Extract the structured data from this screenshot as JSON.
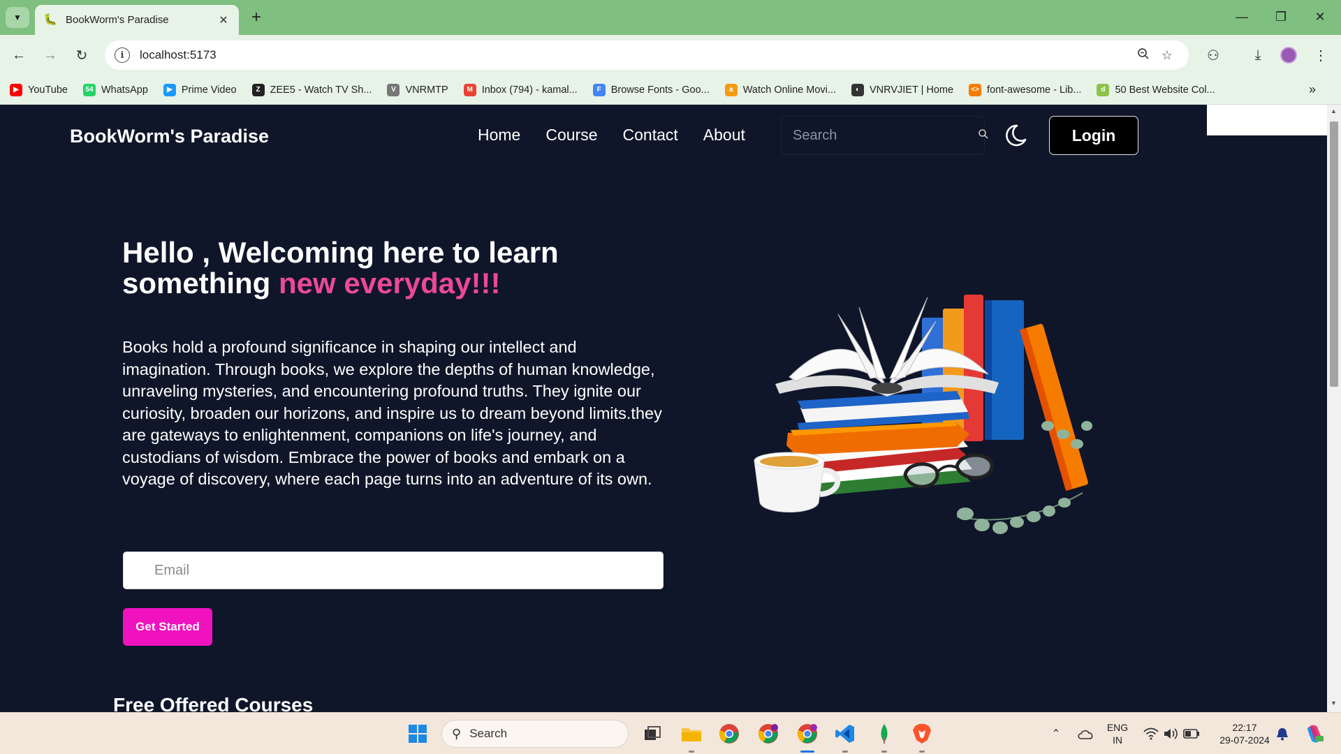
{
  "browser": {
    "tab_title": "BookWorm's Paradise",
    "url": "localhost:5173",
    "new_tab": "+",
    "bookmarks": [
      {
        "label": "YouTube",
        "icon": "youtube-icon",
        "color": "#ff0000",
        "glyph": "▶"
      },
      {
        "label": "WhatsApp",
        "icon": "whatsapp-icon",
        "color": "#25d366",
        "glyph": "54"
      },
      {
        "label": "Prime Video",
        "icon": "prime-video-icon",
        "color": "#1a98ff",
        "glyph": "▶"
      },
      {
        "label": "ZEE5 - Watch TV Sh...",
        "icon": "zee5-icon",
        "color": "#222222",
        "glyph": "Z"
      },
      {
        "label": "VNRMTP",
        "icon": "vnrmtp-icon",
        "color": "#777777",
        "glyph": "V"
      },
      {
        "label": "Inbox (794) - kamal...",
        "icon": "gmail-icon",
        "color": "#ea4335",
        "glyph": "M"
      },
      {
        "label": "Browse Fonts - Goo...",
        "icon": "google-fonts-icon",
        "color": "#4285f4",
        "glyph": "F"
      },
      {
        "label": "Watch Online Movi...",
        "icon": "movies-icon",
        "color": "#f39c12",
        "glyph": "a"
      },
      {
        "label": "VNRVJIET | Home",
        "icon": "vnrvjiet-icon",
        "color": "#333333",
        "glyph": "◐"
      },
      {
        "label": "font-awesome - Lib...",
        "icon": "code-icon",
        "color": "#f57c00",
        "glyph": "<>"
      },
      {
        "label": "50 Best Website Col...",
        "icon": "website-colors-icon",
        "color": "#8bc34a",
        "glyph": "d"
      }
    ]
  },
  "nav": {
    "brand": "BookWorm's Paradise",
    "links": [
      "Home",
      "Course",
      "Contact",
      "About"
    ],
    "search_placeholder": "Search",
    "login": "Login"
  },
  "hero": {
    "title_line1": "Hello , Welcoming here to learn",
    "title_line2_start": "something ",
    "title_accent": "new everyday!!!",
    "body": "Books hold a profound significance in shaping our intellect and imagination. Through books, we explore the depths of human knowledge, unraveling mysteries, and encountering profound truths. They ignite our curiosity, broaden our horizons, and inspire us to dream beyond limits.they are gateways to enlightenment, companions on life's journey, and custodians of wisdom. Embrace the power of books and embark on a voyage of discovery, where each page turns into an adventure of its own.",
    "email_placeholder": "Email",
    "cta": "Get Started"
  },
  "courses": {
    "heading": "Free Offered Courses"
  },
  "taskbar": {
    "search": "Search",
    "lang_line1": "ENG",
    "lang_line2": "IN",
    "time": "22:17",
    "date": "29-07-2024"
  },
  "colors": {
    "page_bg": "#0f1629",
    "accent_pink": "#ec4899",
    "cta_bg": "#f012be",
    "chrome_green": "#7fbf7f"
  }
}
